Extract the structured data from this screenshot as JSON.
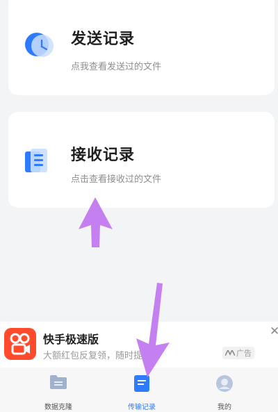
{
  "send_card": {
    "title": "发送记录",
    "subtitle": "点我查看发送过的文件",
    "icon": "clock-icon"
  },
  "receive_card": {
    "title": "接收记录",
    "subtitle": "点击查看接收过的文件",
    "icon": "document-icon"
  },
  "ad": {
    "app_name": "快手极速版",
    "description": "大额红包反复领，随时提现！",
    "badge_label": "广告",
    "close_label": "✕"
  },
  "tabbar": {
    "items": [
      {
        "label": "数据克隆",
        "icon": "folder-icon",
        "active": false
      },
      {
        "label": "传输记录",
        "icon": "record-icon",
        "active": true
      },
      {
        "label": "我的",
        "icon": "profile-icon",
        "active": false
      }
    ]
  },
  "colors": {
    "accent": "#2f7bff",
    "annotation_arrow": "#c47ff0",
    "background": "#f3f4f6"
  }
}
